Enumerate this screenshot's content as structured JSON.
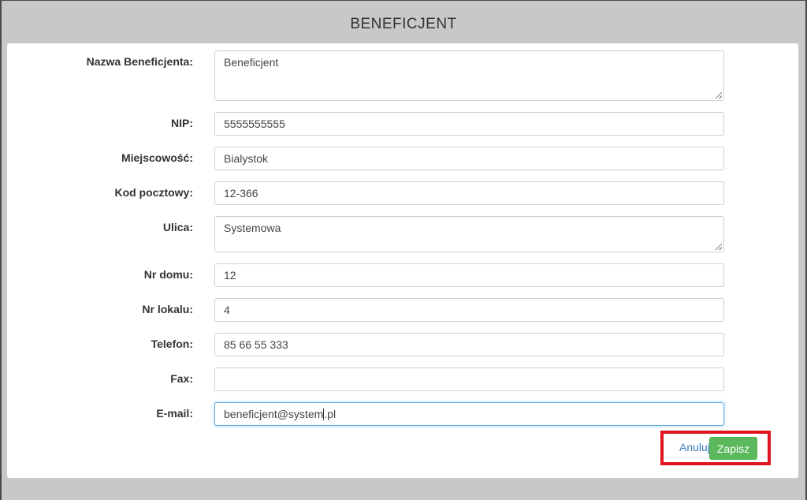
{
  "dialog": {
    "title": "BENEFICJENT"
  },
  "form": {
    "nazwa": {
      "label": "Nazwa Beneficjenta:",
      "value": "Beneficjent"
    },
    "nip": {
      "label": "NIP:",
      "value": "5555555555"
    },
    "miejscowosc": {
      "label": "Miejscowość:",
      "value": "Bialystok"
    },
    "kod": {
      "label": "Kod pocztowy:",
      "value": "12-366"
    },
    "ulica": {
      "label": "Ulica:",
      "value": "Systemowa"
    },
    "nr_domu": {
      "label": "Nr domu:",
      "value": "12"
    },
    "nr_lokalu": {
      "label": "Nr lokalu:",
      "value": "4"
    },
    "telefon": {
      "label": "Telefon:",
      "value": "85 66 55 333"
    },
    "fax": {
      "label": "Fax:",
      "value": ""
    },
    "email": {
      "label": "E-mail:",
      "value_before_caret": "beneficjent@system",
      "value_after_caret": ".pl"
    }
  },
  "actions": {
    "cancel_label": "Anuluj",
    "save_label": "Zapisz"
  },
  "colors": {
    "save_button": "#5cb85c",
    "cancel_link": "#3a7fc1",
    "highlight": "#e0141e",
    "focus_border": "#66afe9"
  }
}
